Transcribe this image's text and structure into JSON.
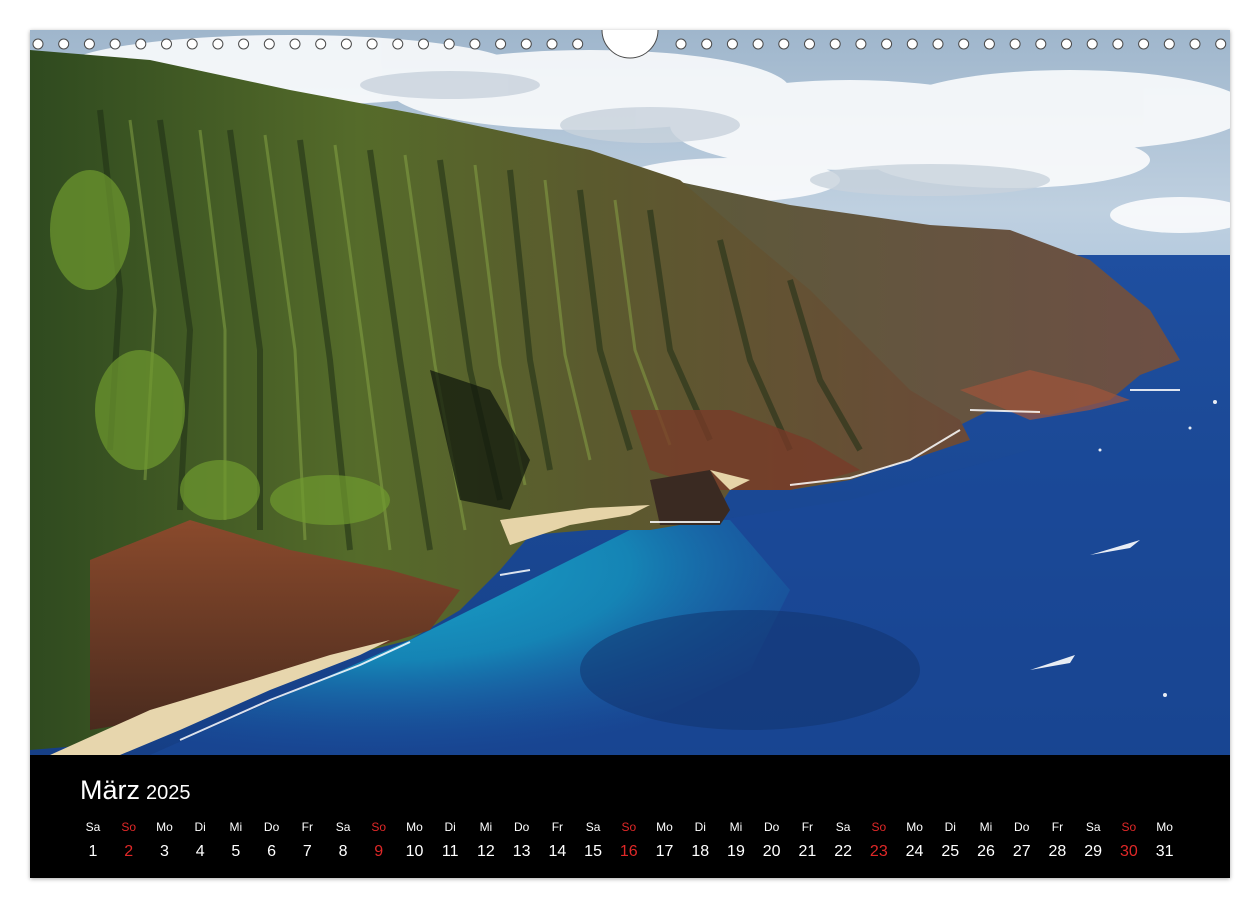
{
  "calendar": {
    "month": "März",
    "year": "2025",
    "sunday_color": "#e02828",
    "days": [
      {
        "abbr": "Sa",
        "num": "1",
        "sunday": false
      },
      {
        "abbr": "So",
        "num": "2",
        "sunday": true
      },
      {
        "abbr": "Mo",
        "num": "3",
        "sunday": false
      },
      {
        "abbr": "Di",
        "num": "4",
        "sunday": false
      },
      {
        "abbr": "Mi",
        "num": "5",
        "sunday": false
      },
      {
        "abbr": "Do",
        "num": "6",
        "sunday": false
      },
      {
        "abbr": "Fr",
        "num": "7",
        "sunday": false
      },
      {
        "abbr": "Sa",
        "num": "8",
        "sunday": false
      },
      {
        "abbr": "So",
        "num": "9",
        "sunday": true
      },
      {
        "abbr": "Mo",
        "num": "10",
        "sunday": false
      },
      {
        "abbr": "Di",
        "num": "11",
        "sunday": false
      },
      {
        "abbr": "Mi",
        "num": "12",
        "sunday": false
      },
      {
        "abbr": "Do",
        "num": "13",
        "sunday": false
      },
      {
        "abbr": "Fr",
        "num": "14",
        "sunday": false
      },
      {
        "abbr": "Sa",
        "num": "15",
        "sunday": false
      },
      {
        "abbr": "So",
        "num": "16",
        "sunday": true
      },
      {
        "abbr": "Mo",
        "num": "17",
        "sunday": false
      },
      {
        "abbr": "Di",
        "num": "18",
        "sunday": false
      },
      {
        "abbr": "Mi",
        "num": "19",
        "sunday": false
      },
      {
        "abbr": "Do",
        "num": "20",
        "sunday": false
      },
      {
        "abbr": "Fr",
        "num": "21",
        "sunday": false
      },
      {
        "abbr": "Sa",
        "num": "22",
        "sunday": false
      },
      {
        "abbr": "So",
        "num": "23",
        "sunday": true
      },
      {
        "abbr": "Mo",
        "num": "24",
        "sunday": false
      },
      {
        "abbr": "Di",
        "num": "25",
        "sunday": false
      },
      {
        "abbr": "Mi",
        "num": "26",
        "sunday": false
      },
      {
        "abbr": "Do",
        "num": "27",
        "sunday": false
      },
      {
        "abbr": "Fr",
        "num": "28",
        "sunday": false
      },
      {
        "abbr": "Sa",
        "num": "29",
        "sunday": false
      },
      {
        "abbr": "So",
        "num": "30",
        "sunday": true
      },
      {
        "abbr": "Mo",
        "num": "31",
        "sunday": false
      }
    ]
  },
  "photo": {
    "subject": "coastal-cliffs-landscape"
  }
}
